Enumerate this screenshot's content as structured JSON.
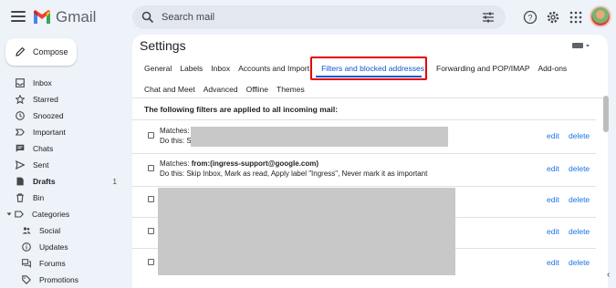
{
  "app": {
    "name": "Gmail"
  },
  "search": {
    "placeholder": "Search mail"
  },
  "compose": {
    "label": "Compose"
  },
  "sidebar": {
    "items": [
      {
        "label": "Inbox",
        "icon": "inbox-icon"
      },
      {
        "label": "Starred",
        "icon": "star-icon"
      },
      {
        "label": "Snoozed",
        "icon": "clock-icon"
      },
      {
        "label": "Important",
        "icon": "label-important-icon"
      },
      {
        "label": "Chats",
        "icon": "chat-icon"
      },
      {
        "label": "Sent",
        "icon": "send-icon"
      },
      {
        "label": "Drafts",
        "icon": "draft-icon",
        "count": "1",
        "bold": true
      },
      {
        "label": "Bin",
        "icon": "trash-icon"
      }
    ],
    "categories_label": "Categories",
    "categories": [
      {
        "label": "Social",
        "icon": "people-icon"
      },
      {
        "label": "Updates",
        "icon": "info-icon"
      },
      {
        "label": "Forums",
        "icon": "forum-icon"
      },
      {
        "label": "Promotions",
        "icon": "tag-icon"
      }
    ]
  },
  "settings": {
    "title": "Settings",
    "tabs_row1": [
      "General",
      "Labels",
      "Inbox",
      "Accounts and Import",
      "Filters and blocked addresses",
      "Forwarding and POP/IMAP",
      "Add-ons"
    ],
    "tabs_row2": [
      "Chat and Meet",
      "Advanced",
      "Offline",
      "Themes"
    ],
    "active_tab": "Filters and blocked addresses",
    "filters_heading": "The following filters are applied to all incoming mail:",
    "filters": [
      {
        "matches_label": "Matches:",
        "matches_value": "",
        "do_label": "Do this: S",
        "do_value": "",
        "edit": "edit",
        "delete": "delete"
      },
      {
        "matches_label": "Matches: ",
        "matches_value": "from:(ingress-support@google.com)",
        "do_label": "Do this: ",
        "do_value": "Skip Inbox, Mark as read, Apply label \"Ingress\", Never mark it as important",
        "edit": "edit",
        "delete": "delete"
      },
      {
        "edit": "edit",
        "delete": "delete"
      },
      {
        "edit": "edit",
        "delete": "delete"
      },
      {
        "edit": "edit",
        "delete": "delete"
      }
    ]
  },
  "colors": {
    "accent": "#0b57d0",
    "link": "#1a73e8",
    "highlight_outline": "#e30000",
    "background": "#eef2f9"
  }
}
